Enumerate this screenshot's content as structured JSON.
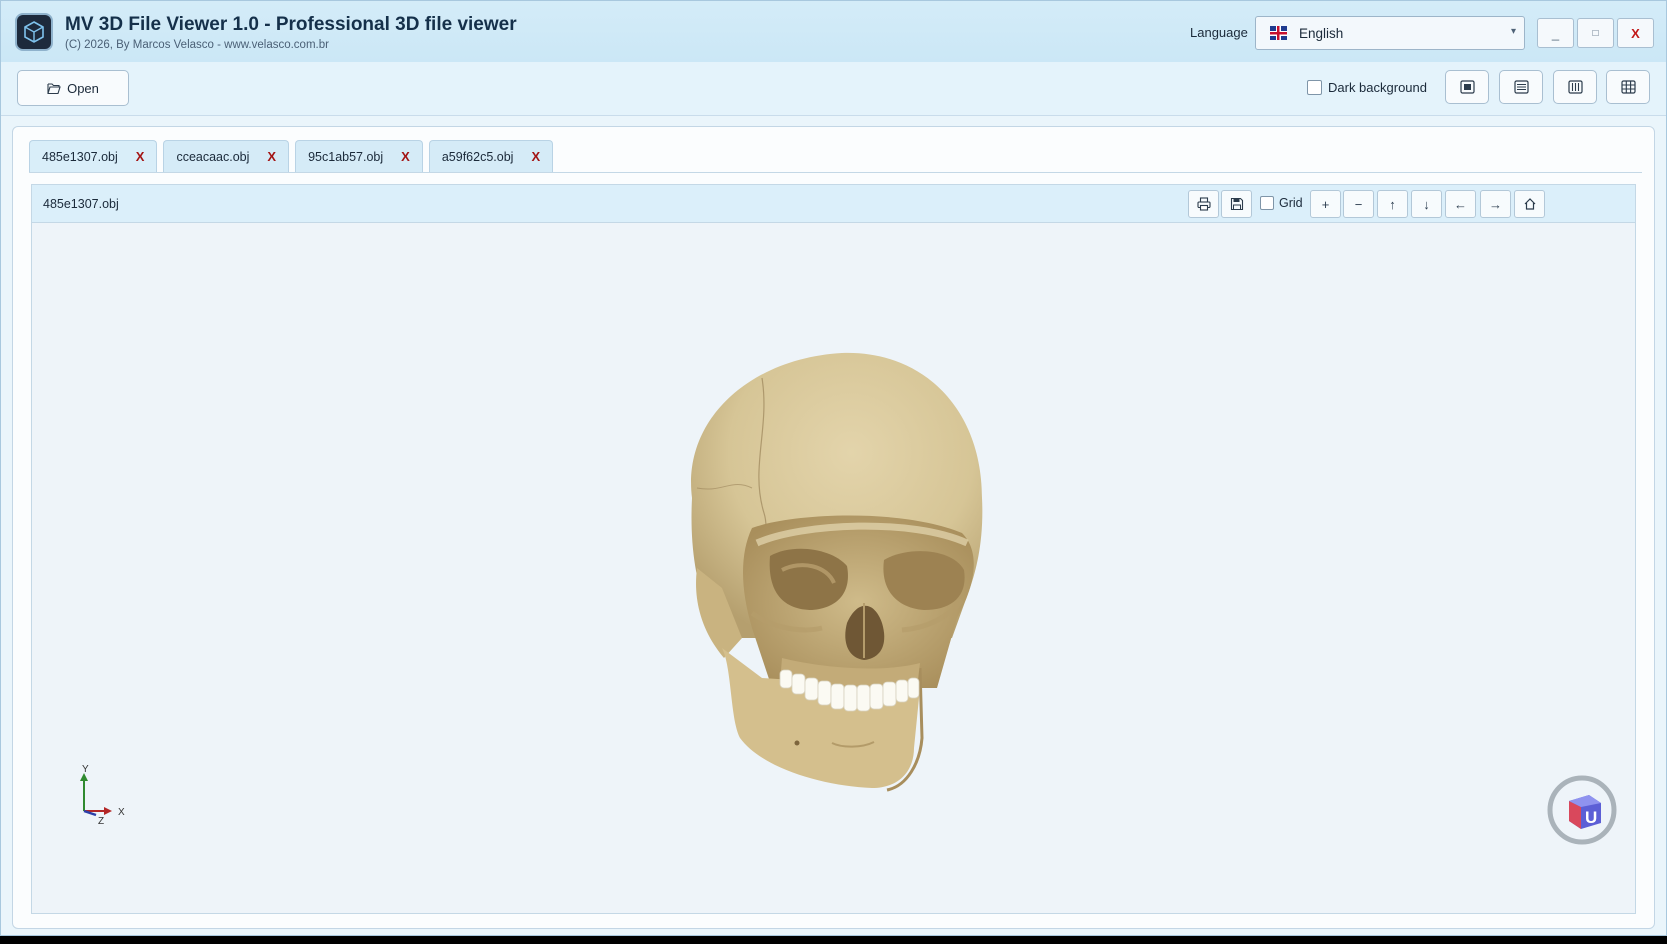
{
  "window": {
    "title": "MV 3D File Viewer 1.0 - Professional 3D file viewer",
    "subtitle": "(C) 2026, By Marcos Velasco - www.velasco.com.br",
    "language_label": "Language",
    "language_value": "English",
    "minimize_label": "_",
    "maximize_label": "□",
    "close_label": "X"
  },
  "toolbar": {
    "open_label": "Open",
    "dark_background_label": "Dark background",
    "dark_background_checked": false,
    "view_buttons": [
      "single-view-icon",
      "horizontal-split-icon",
      "vertical-split-icon",
      "grid-view-icon"
    ]
  },
  "tabs": [
    {
      "label": "485e1307.obj",
      "close": "X",
      "active": true
    },
    {
      "label": "cceacaac.obj",
      "close": "X",
      "active": false
    },
    {
      "label": "95c1ab57.obj",
      "close": "X",
      "active": false
    },
    {
      "label": "a59f62c5.obj",
      "close": "X",
      "active": false
    }
  ],
  "document": {
    "title": "485e1307.obj",
    "grid_label": "Grid",
    "grid_checked": false,
    "tools": {
      "zoom_in": "+",
      "zoom_out": "−",
      "pan_up": "↑",
      "pan_down": "↓",
      "pan_left": "←",
      "pan_right": "→"
    }
  },
  "viewport": {
    "model": "skull",
    "axes": {
      "y": "Y",
      "x": "X",
      "z": "Z"
    },
    "colors": {
      "bone": "#d9c9a0",
      "teeth": "#fbfaf3",
      "background": "#eef4f9"
    }
  }
}
